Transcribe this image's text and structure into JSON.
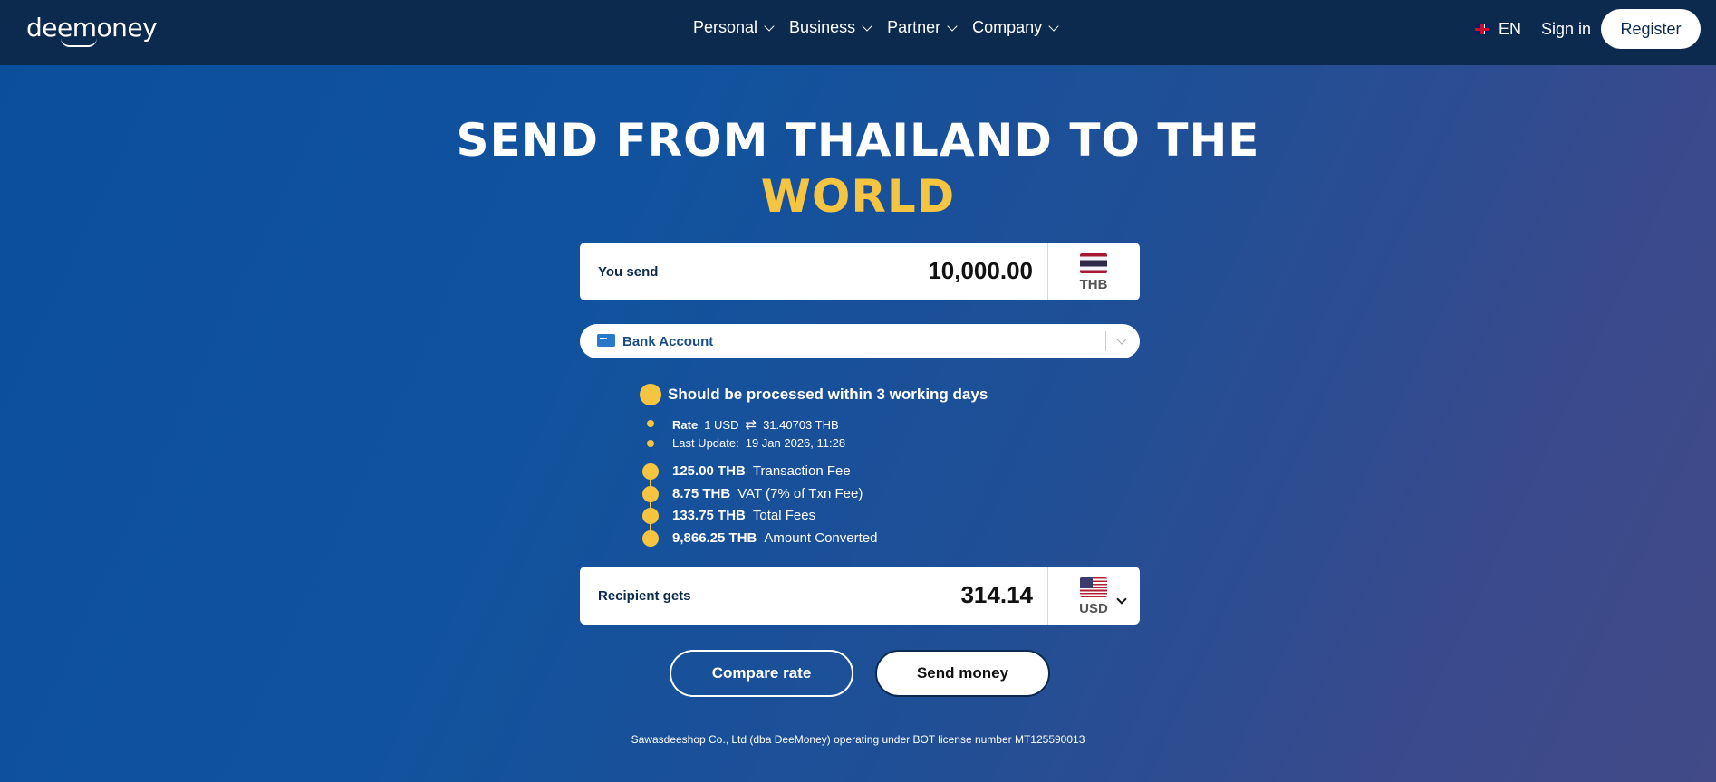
{
  "header": {
    "logo": "deemoney",
    "nav": [
      {
        "label": "Personal"
      },
      {
        "label": "Business"
      },
      {
        "label": "Partner"
      },
      {
        "label": "Company"
      }
    ],
    "language": "EN",
    "sign_in": "Sign in",
    "register": "Register"
  },
  "hero": {
    "title": "SEND FROM THAILAND TO THE",
    "accent": "WORLD"
  },
  "send": {
    "label": "You send",
    "amount": "10,000.00",
    "currency": "THB"
  },
  "method": {
    "label": "Bank Account"
  },
  "info": {
    "processing": "Should be processed within 3 working days",
    "rate_label": "Rate",
    "rate_from": "1 USD",
    "rate_to": "31.40703 THB",
    "last_update_label": "Last Update:",
    "last_update_value": "19 Jan 2026, 11:28",
    "fees": [
      {
        "amount": "125.00 THB",
        "label": "Transaction Fee"
      },
      {
        "amount": "8.75 THB",
        "label": "VAT (7% of Txn Fee)"
      },
      {
        "amount": "133.75 THB",
        "label": "Total Fees"
      },
      {
        "amount": "9,866.25 THB",
        "label": "Amount Converted"
      }
    ]
  },
  "receive": {
    "label": "Recipient gets",
    "amount": "314.14",
    "currency": "USD"
  },
  "buttons": {
    "compare": "Compare rate",
    "send": "Send money"
  },
  "footer": {
    "note": "Sawasdeeshop Co., Ltd (dba DeeMoney) operating under BOT license number MT125590013"
  },
  "colors": {
    "accent": "#f5c542",
    "header_bg": "#0b2a4d",
    "page_bg": "#11529e"
  }
}
